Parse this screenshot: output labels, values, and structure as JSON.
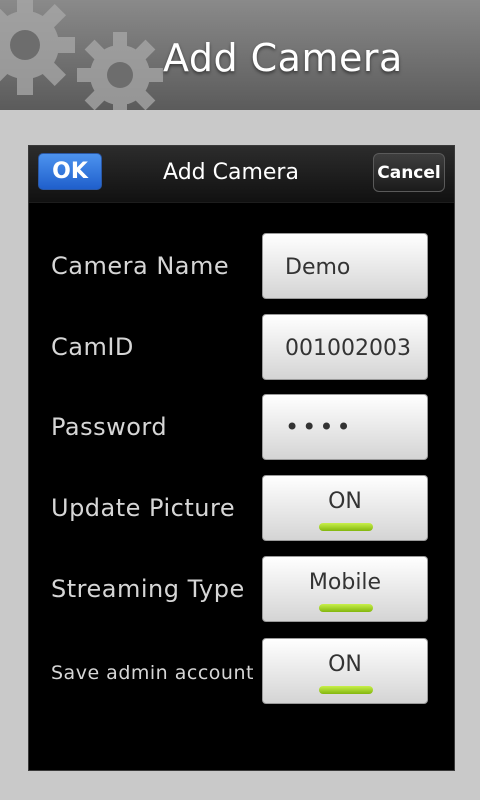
{
  "app": {
    "title": "Add Camera"
  },
  "dialog": {
    "title": "Add Camera",
    "ok_label": "OK",
    "cancel_label": "Cancel"
  },
  "fields": {
    "camera_name": {
      "label": "Camera Name",
      "value": "Demo"
    },
    "cam_id": {
      "label": "CamID",
      "value": "001002003"
    },
    "password": {
      "label": "Password",
      "value": "••••"
    },
    "update_picture": {
      "label": "Update Picture",
      "value": "ON"
    },
    "streaming_type": {
      "label": "Streaming Type",
      "value": "Mobile"
    },
    "save_admin": {
      "label": "Save admin account",
      "value": "ON"
    }
  },
  "colors": {
    "ok_blue": "#1f5fcc",
    "toggle_green": "#9ad11a",
    "dialog_bg": "#000000",
    "page_bg": "#c9c9c9"
  }
}
